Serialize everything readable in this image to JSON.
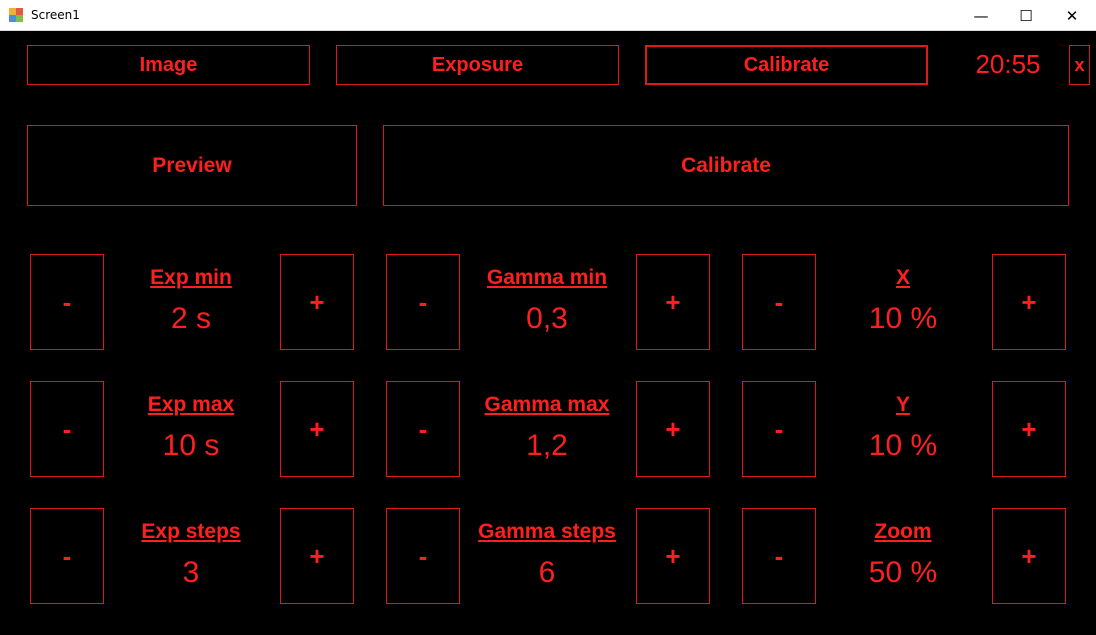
{
  "window": {
    "title": "Screen1",
    "minimize_glyph": "—",
    "maximize_glyph": "☐",
    "close_glyph": "✕"
  },
  "header": {
    "tabs": [
      {
        "label": "Image"
      },
      {
        "label": "Exposure"
      },
      {
        "label": "Calibrate"
      }
    ],
    "clock": "20:55",
    "close_label": "x"
  },
  "actions": {
    "preview_label": "Preview",
    "calibrate_label": "Calibrate"
  },
  "controls": {
    "minus": "-",
    "plus": "+"
  },
  "params": {
    "exp_min": {
      "label": "Exp min",
      "value": "2 s"
    },
    "exp_max": {
      "label": "Exp max",
      "value": "10 s"
    },
    "exp_steps": {
      "label": "Exp steps",
      "value": "3"
    },
    "gamma_min": {
      "label": "Gamma min",
      "value": "0,3"
    },
    "gamma_max": {
      "label": "Gamma max",
      "value": "1,2"
    },
    "gamma_steps": {
      "label": "Gamma steps",
      "value": "6"
    },
    "x": {
      "label": "X",
      "value": "10 %"
    },
    "y": {
      "label": "Y",
      "value": "10 %"
    },
    "zoom": {
      "label": "Zoom",
      "value": "50 %"
    }
  },
  "colors": {
    "background": "#000000",
    "accent_red": "#ff1f1f",
    "border_red": "#e0171b"
  },
  "icons": {
    "app": "app-window-icon",
    "minimize": "minimize-icon",
    "maximize": "maximize-icon",
    "close": "close-icon"
  }
}
